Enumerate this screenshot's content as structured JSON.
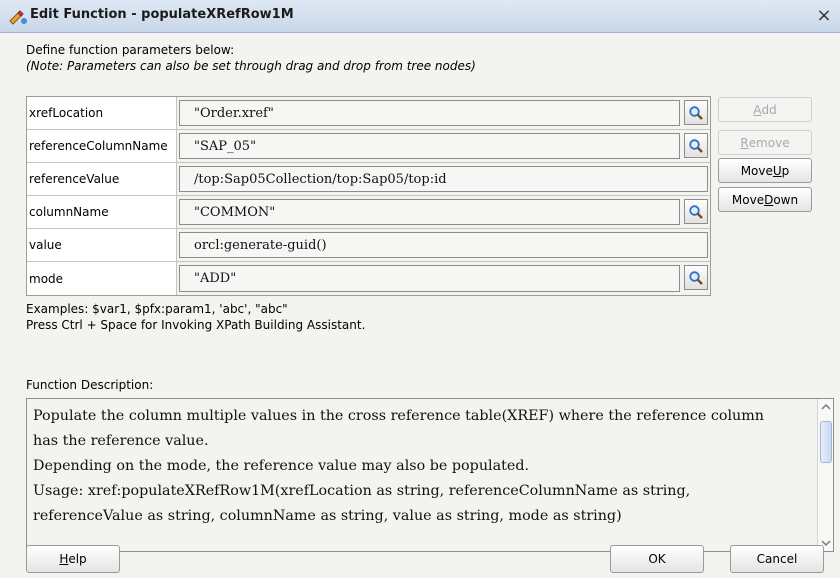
{
  "window": {
    "title": "Edit Function - populateXRefRow1M",
    "close_glyph": "×"
  },
  "intro": {
    "line1": "Define function parameters below:",
    "line2": "(Note: Parameters can also be set through drag and drop from tree nodes)"
  },
  "params": [
    {
      "name": "xrefLocation",
      "value": "\"Order.xref\"",
      "has_search": true
    },
    {
      "name": "referenceColumnName",
      "value": "\"SAP_05\"",
      "has_search": true
    },
    {
      "name": "referenceValue",
      "value": "/top:Sap05Collection/top:Sap05/top:id",
      "has_search": false
    },
    {
      "name": "columnName",
      "value": "\"COMMON\"",
      "has_search": true
    },
    {
      "name": "value",
      "value": "orcl:generate-guid()",
      "has_search": false
    },
    {
      "name": "mode",
      "value": "\"ADD\"",
      "has_search": true
    }
  ],
  "side_buttons": {
    "add": {
      "pre": "",
      "mnemonic": "A",
      "post": "dd"
    },
    "remove": {
      "pre": "",
      "mnemonic": "R",
      "post": "emove"
    },
    "move_up": {
      "pre": "Move ",
      "mnemonic": "U",
      "post": "p"
    },
    "move_down": {
      "pre": "Move ",
      "mnemonic": "D",
      "post": "own"
    }
  },
  "examples": {
    "line1": "Examples: $var1, $pfx:param1, 'abc', \"abc\"",
    "line2": "Press Ctrl + Space for Invoking XPath Building Assistant."
  },
  "description": {
    "label": "Function Description:",
    "lines": [
      "Populate the column multiple values in the cross reference table(XREF) where the reference column",
      "has the reference value.",
      "Depending on the mode, the reference value may also be populated.",
      "Usage: xref:populateXRefRow1M(xrefLocation as string, referenceColumnName as string,",
      "referenceValue as string, columnName as string, value as string, mode as string)"
    ]
  },
  "footer": {
    "help": {
      "pre": "",
      "mnemonic": "H",
      "post": "elp"
    },
    "ok": "OK",
    "cancel": "Cancel"
  },
  "icons": {
    "title": "edit-function-icon",
    "search": "search-icon"
  },
  "colors": {
    "titlebar": "#c9d7ea",
    "dialog_bg": "#f3f3f0",
    "search_lens": "#2f6fc4"
  }
}
